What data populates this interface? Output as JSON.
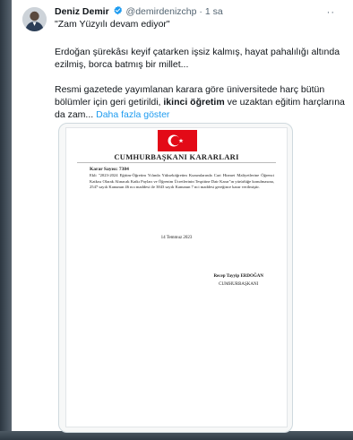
{
  "tweet": {
    "author_name": "Deniz Demir",
    "handle": "@demirdenizchp",
    "separator": "·",
    "time": "1 sa",
    "quote": "\"Zam Yüzyılı devam ediyor\"",
    "paragraph1": "Erdoğan şürekâsı keyif çatarken işsiz kalmış, hayat pahalılığı altında ezilmiş, borca batmış bir millet...",
    "paragraph2_start": "Resmi gazetede yayımlanan karara göre üniversitede harç bütün bölümler için geri getirildi, ",
    "paragraph2_bold": "ikinci öğretim",
    "paragraph2_end": " ve uzaktan eğitim harçlarına da zam... ",
    "show_more": "Daha fazla göster",
    "verified_color": "#1d9bf0",
    "more_icon": "more-icon"
  },
  "document": {
    "title": "CUMHURBAŞKANI KARARLARI",
    "decision_no": "Karar Sayısı: 7384",
    "text": "Ekli \"2023-2024 Eğitim-Öğretim Yılında Yükseköğretim Kurumlarında Cari Hizmet Maliyetlerine Öğrenci Katkısı Olarak Alınacak Katkı Payları ve Öğrenim Ücretlerinin Tespitine Dair Karar\"ın yürürlüğe konulmasına, 2547 sayılı Kanunun 46 ncı maddesi ile 3843 sayılı Kanunun 7 nci maddesi gereğince karar verilmiştir.",
    "date": "14 Temmuz 2023",
    "signer_name": "Recep Tayyip ERDOĞAN",
    "signer_title": "CUMHURBAŞKANI",
    "flag_color": "#e30a17"
  }
}
